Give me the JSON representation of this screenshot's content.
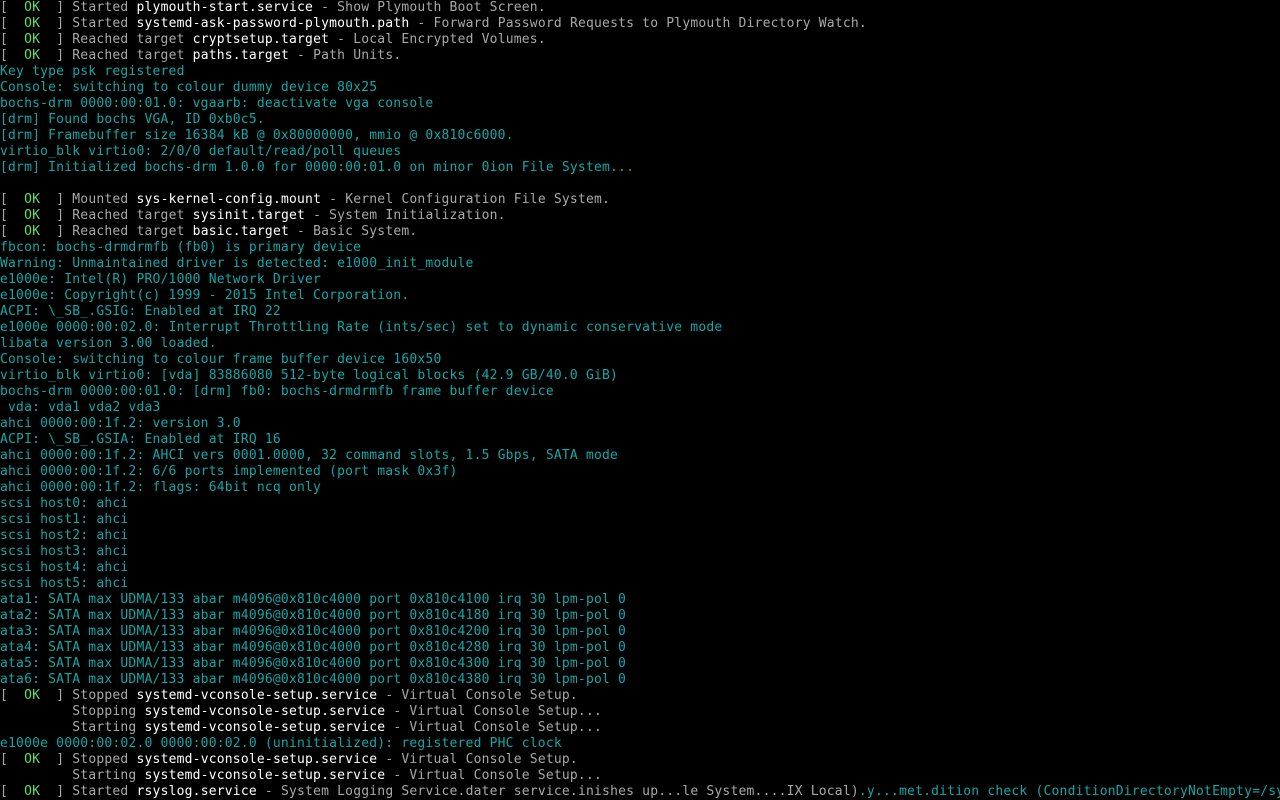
{
  "colors": {
    "background": "#000000",
    "normal_text": "#a8a8a8",
    "kernel_text": "#12a7a7",
    "ok_status": "#5ce05c",
    "unit_name": "#ffffff"
  },
  "console_lines": [
    {
      "type": "unit",
      "segments": [
        {
          "s": "dim",
          "t": "[  "
        },
        {
          "s": "ok",
          "t": "OK"
        },
        {
          "s": "dim",
          "t": "  ] Started "
        },
        {
          "s": "bright",
          "t": "plymouth-start.service"
        },
        {
          "s": "dim",
          "t": " - Show Plymouth Boot Screen."
        }
      ]
    },
    {
      "type": "unit",
      "segments": [
        {
          "s": "dim",
          "t": "[  "
        },
        {
          "s": "ok",
          "t": "OK"
        },
        {
          "s": "dim",
          "t": "  ] Started "
        },
        {
          "s": "bright",
          "t": "systemd-ask-password-plymouth.path"
        },
        {
          "s": "dim",
          "t": " - Forward Password Requests to Plymouth Directory Watch."
        }
      ]
    },
    {
      "type": "unit",
      "segments": [
        {
          "s": "dim",
          "t": "[  "
        },
        {
          "s": "ok",
          "t": "OK"
        },
        {
          "s": "dim",
          "t": "  ] Reached target "
        },
        {
          "s": "bright",
          "t": "cryptsetup.target"
        },
        {
          "s": "dim",
          "t": " - Local Encrypted Volumes."
        }
      ]
    },
    {
      "type": "unit",
      "segments": [
        {
          "s": "dim",
          "t": "[  "
        },
        {
          "s": "ok",
          "t": "OK"
        },
        {
          "s": "dim",
          "t": "  ] Reached target "
        },
        {
          "s": "bright",
          "t": "paths.target"
        },
        {
          "s": "dim",
          "t": " - Path Units."
        }
      ]
    },
    {
      "type": "kernel",
      "text": "Key type psk registered"
    },
    {
      "type": "kernel",
      "text": "Console: switching to colour dummy device 80x25"
    },
    {
      "type": "kernel",
      "text": "bochs-drm 0000:00:01.0: vgaarb: deactivate vga console"
    },
    {
      "type": "kernel",
      "text": "[drm] Found bochs VGA, ID 0xb0c5."
    },
    {
      "type": "kernel",
      "text": "[drm] Framebuffer size 16384 kB @ 0x80000000, mmio @ 0x810c6000."
    },
    {
      "type": "kernel",
      "text": "virtio_blk virtio0: 2/0/0 default/read/poll queues"
    },
    {
      "type": "kernel",
      "text": "[drm] Initialized bochs-drm 1.0.0 for 0000:00:01.0 on minor 0ion File System..."
    },
    {
      "type": "blank",
      "text": ""
    },
    {
      "type": "unit",
      "segments": [
        {
          "s": "dim",
          "t": "[  "
        },
        {
          "s": "ok",
          "t": "OK"
        },
        {
          "s": "dim",
          "t": "  ] Mounted "
        },
        {
          "s": "bright",
          "t": "sys-kernel-config.mount"
        },
        {
          "s": "dim",
          "t": " - Kernel Configuration File System."
        }
      ]
    },
    {
      "type": "unit",
      "segments": [
        {
          "s": "dim",
          "t": "[  "
        },
        {
          "s": "ok",
          "t": "OK"
        },
        {
          "s": "dim",
          "t": "  ] Reached target "
        },
        {
          "s": "bright",
          "t": "sysinit.target"
        },
        {
          "s": "dim",
          "t": " - System Initialization."
        }
      ]
    },
    {
      "type": "unit",
      "segments": [
        {
          "s": "dim",
          "t": "[  "
        },
        {
          "s": "ok",
          "t": "OK"
        },
        {
          "s": "dim",
          "t": "  ] Reached target "
        },
        {
          "s": "bright",
          "t": "basic.target"
        },
        {
          "s": "dim",
          "t": " - Basic System."
        }
      ]
    },
    {
      "type": "kernel",
      "text": "fbcon: bochs-drmdrmfb (fb0) is primary device"
    },
    {
      "type": "kernel",
      "text": "Warning: Unmaintained driver is detected: e1000_init_module"
    },
    {
      "type": "kernel",
      "text": "e1000e: Intel(R) PRO/1000 Network Driver"
    },
    {
      "type": "kernel",
      "text": "e1000e: Copyright(c) 1999 - 2015 Intel Corporation."
    },
    {
      "type": "kernel",
      "text": "ACPI: \\_SB_.GSIG: Enabled at IRQ 22"
    },
    {
      "type": "kernel",
      "text": "e1000e 0000:00:02.0: Interrupt Throttling Rate (ints/sec) set to dynamic conservative mode"
    },
    {
      "type": "kernel",
      "text": "libata version 3.00 loaded."
    },
    {
      "type": "kernel",
      "text": "Console: switching to colour frame buffer device 160x50"
    },
    {
      "type": "kernel",
      "text": "virtio_blk virtio0: [vda] 83886080 512-byte logical blocks (42.9 GB/40.0 GiB)"
    },
    {
      "type": "kernel",
      "text": "bochs-drm 0000:00:01.0: [drm] fb0: bochs-drmdrmfb frame buffer device"
    },
    {
      "type": "kernel",
      "text": " vda: vda1 vda2 vda3"
    },
    {
      "type": "kernel",
      "text": "ahci 0000:00:1f.2: version 3.0"
    },
    {
      "type": "kernel",
      "text": "ACPI: \\_SB_.GSIA: Enabled at IRQ 16"
    },
    {
      "type": "kernel",
      "text": "ahci 0000:00:1f.2: AHCI vers 0001.0000, 32 command slots, 1.5 Gbps, SATA mode"
    },
    {
      "type": "kernel",
      "text": "ahci 0000:00:1f.2: 6/6 ports implemented (port mask 0x3f)"
    },
    {
      "type": "kernel",
      "text": "ahci 0000:00:1f.2: flags: 64bit ncq only"
    },
    {
      "type": "kernel",
      "text": "scsi host0: ahci"
    },
    {
      "type": "kernel",
      "text": "scsi host1: ahci"
    },
    {
      "type": "kernel",
      "text": "scsi host2: ahci"
    },
    {
      "type": "kernel",
      "text": "scsi host3: ahci"
    },
    {
      "type": "kernel",
      "text": "scsi host4: ahci"
    },
    {
      "type": "kernel",
      "text": "scsi host5: ahci"
    },
    {
      "type": "kernel",
      "text": "ata1: SATA max UDMA/133 abar m4096@0x810c4000 port 0x810c4100 irq 30 lpm-pol 0"
    },
    {
      "type": "kernel",
      "text": "ata2: SATA max UDMA/133 abar m4096@0x810c4000 port 0x810c4180 irq 30 lpm-pol 0"
    },
    {
      "type": "kernel",
      "text": "ata3: SATA max UDMA/133 abar m4096@0x810c4000 port 0x810c4200 irq 30 lpm-pol 0"
    },
    {
      "type": "kernel",
      "text": "ata4: SATA max UDMA/133 abar m4096@0x810c4000 port 0x810c4280 irq 30 lpm-pol 0"
    },
    {
      "type": "kernel",
      "text": "ata5: SATA max UDMA/133 abar m4096@0x810c4000 port 0x810c4300 irq 30 lpm-pol 0"
    },
    {
      "type": "kernel",
      "text": "ata6: SATA max UDMA/133 abar m4096@0x810c4000 port 0x810c4380 irq 30 lpm-pol 0"
    },
    {
      "type": "unit",
      "segments": [
        {
          "s": "dim",
          "t": "[  "
        },
        {
          "s": "ok",
          "t": "OK"
        },
        {
          "s": "dim",
          "t": "  ] Stopped "
        },
        {
          "s": "bright",
          "t": "systemd-vconsole-setup.service"
        },
        {
          "s": "dim",
          "t": " - Virtual Console Setup."
        }
      ]
    },
    {
      "type": "unit",
      "segments": [
        {
          "s": "dim",
          "t": "         Stopping "
        },
        {
          "s": "bright",
          "t": "systemd-vconsole-setup.service"
        },
        {
          "s": "dim",
          "t": " - Virtual Console Setup..."
        }
      ]
    },
    {
      "type": "unit",
      "segments": [
        {
          "s": "dim",
          "t": "         Starting "
        },
        {
          "s": "bright",
          "t": "systemd-vconsole-setup.service"
        },
        {
          "s": "dim",
          "t": " - Virtual Console Setup..."
        }
      ]
    },
    {
      "type": "kernel",
      "text": "e1000e 0000:00:02.0 0000:00:02.0 (uninitialized): registered PHC clock"
    },
    {
      "type": "unit",
      "segments": [
        {
          "s": "dim",
          "t": "[  "
        },
        {
          "s": "ok",
          "t": "OK"
        },
        {
          "s": "dim",
          "t": "  ] Stopped "
        },
        {
          "s": "bright",
          "t": "systemd-vconsole-setup.service"
        },
        {
          "s": "dim",
          "t": " - Virtual Console Setup."
        }
      ]
    },
    {
      "type": "unit",
      "segments": [
        {
          "s": "dim",
          "t": "         Starting "
        },
        {
          "s": "bright",
          "t": "systemd-vconsole-setup.service"
        },
        {
          "s": "dim",
          "t": " - Virtual Console Setup..."
        }
      ]
    },
    {
      "type": "unit",
      "segments": [
        {
          "s": "dim",
          "t": "[  "
        },
        {
          "s": "ok",
          "t": "OK"
        },
        {
          "s": "dim",
          "t": "  ] Started "
        },
        {
          "s": "bright",
          "t": "rsyslog.service"
        },
        {
          "s": "dim",
          "t": " - System Logging Service.dater service.inishes up...le System....IX Local)"
        },
        {
          "s": "cyan",
          "t": ".y...met.dition check (ConditionDirectoryNotEmpty=/sy"
        }
      ]
    }
  ]
}
